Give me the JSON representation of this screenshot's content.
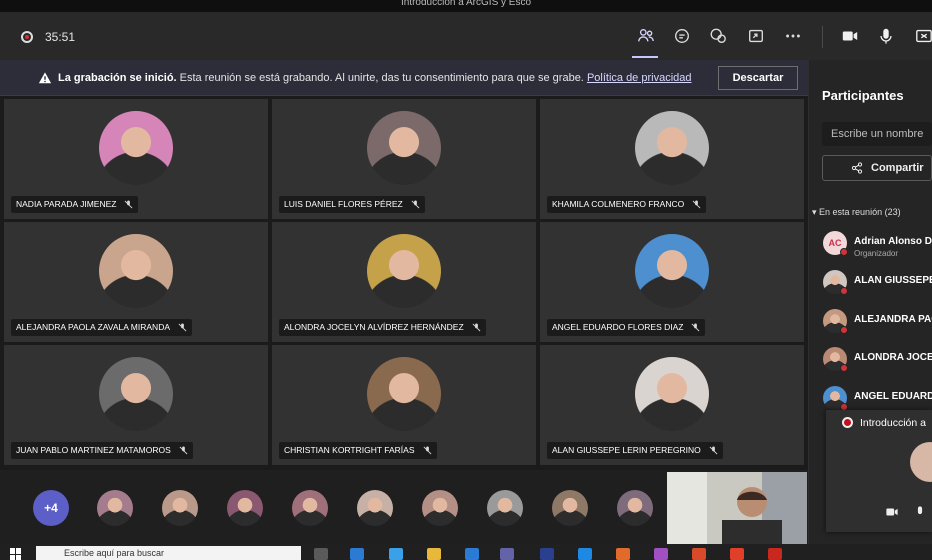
{
  "window": {
    "title": "Introducción a ArcGIS y Esco"
  },
  "toolbar": {
    "timer": "35:51",
    "icons": [
      "people-icon",
      "chat-icon",
      "reactions-icon",
      "share-tray-icon",
      "more-icon",
      "camera-icon",
      "mic-icon",
      "share-icon"
    ]
  },
  "banner": {
    "bold": "La grabación se inició.",
    "text": "Esta reunión se está grabando. Al unirte, das tu consentimiento para que se grabe.",
    "link": "Política de privacidad",
    "dismiss": "Descartar"
  },
  "tiles": [
    {
      "name": "NADIA PARADA JIMENEZ",
      "color": "#d685b8"
    },
    {
      "name": "LUIS DANIEL FLORES PÉREZ",
      "color": "#7c6a6a"
    },
    {
      "name": "KHAMILA COLMENERO FRANCO",
      "color": "#b9b9b9"
    },
    {
      "name": "ALEJANDRA PAOLA ZAVALA MIRANDA",
      "color": "#c9a58d"
    },
    {
      "name": "ALONDRA JOCELYN ALVÍDREZ HERNÁNDEZ",
      "color": "#c5a24a"
    },
    {
      "name": "ANGEL EDUARDO FLORES DIAZ",
      "color": "#4d8fcf"
    },
    {
      "name": "JUAN PABLO MARTINEZ MATAMOROS",
      "color": "#6b6b6b"
    },
    {
      "name": "CHRISTIAN KORTRIGHT FARÍAS",
      "color": "#8a6a4e"
    },
    {
      "name": "ALAN GIUSSEPE LERIN PEREGRINO",
      "color": "#d9d4cf"
    }
  ],
  "strip": {
    "overflow": "+4",
    "colors": [
      "#a47c8e",
      "#b99a8a",
      "#8a5870",
      "#a0707a",
      "#c7b1a6",
      "#b48f86",
      "#9a9a9a",
      "#8e7866",
      "#7e6b7b"
    ]
  },
  "panel": {
    "title": "Participantes",
    "search_placeholder": "Escribe un nombre",
    "share": "Compartir",
    "section": "En esta reunión (23)",
    "participants": [
      {
        "name": "Adrian Alonso D",
        "sub": "Organizador",
        "initials": "AC",
        "color": "#f2d8d8"
      },
      {
        "name": "ALAN GIUSSEPE",
        "sub": "",
        "initials": "",
        "color": "#cfc7c0"
      },
      {
        "name": "ALEJANDRA PAC",
        "sub": "",
        "initials": "",
        "color": "#c39a80"
      },
      {
        "name": "ALONDRA JOCEL",
        "sub": "",
        "initials": "",
        "color": "#b98a74"
      },
      {
        "name": "ANGEL EDUARD",
        "sub": "",
        "initials": "",
        "color": "#4d8fcf"
      }
    ]
  },
  "popup": {
    "title": "Introducción a"
  },
  "taskbar": {
    "search": "Escribe aquí para buscar",
    "apps": [
      "#5a5a5a",
      "#2b7bd4",
      "#3aa0e8",
      "#e8b83a",
      "#2b7bd4",
      "#6264a7",
      "#2b3f8f",
      "#1e88e5",
      "#e06b2a",
      "#a050c0",
      "#d84a2a",
      "#e0402a",
      "#c8281e"
    ]
  }
}
